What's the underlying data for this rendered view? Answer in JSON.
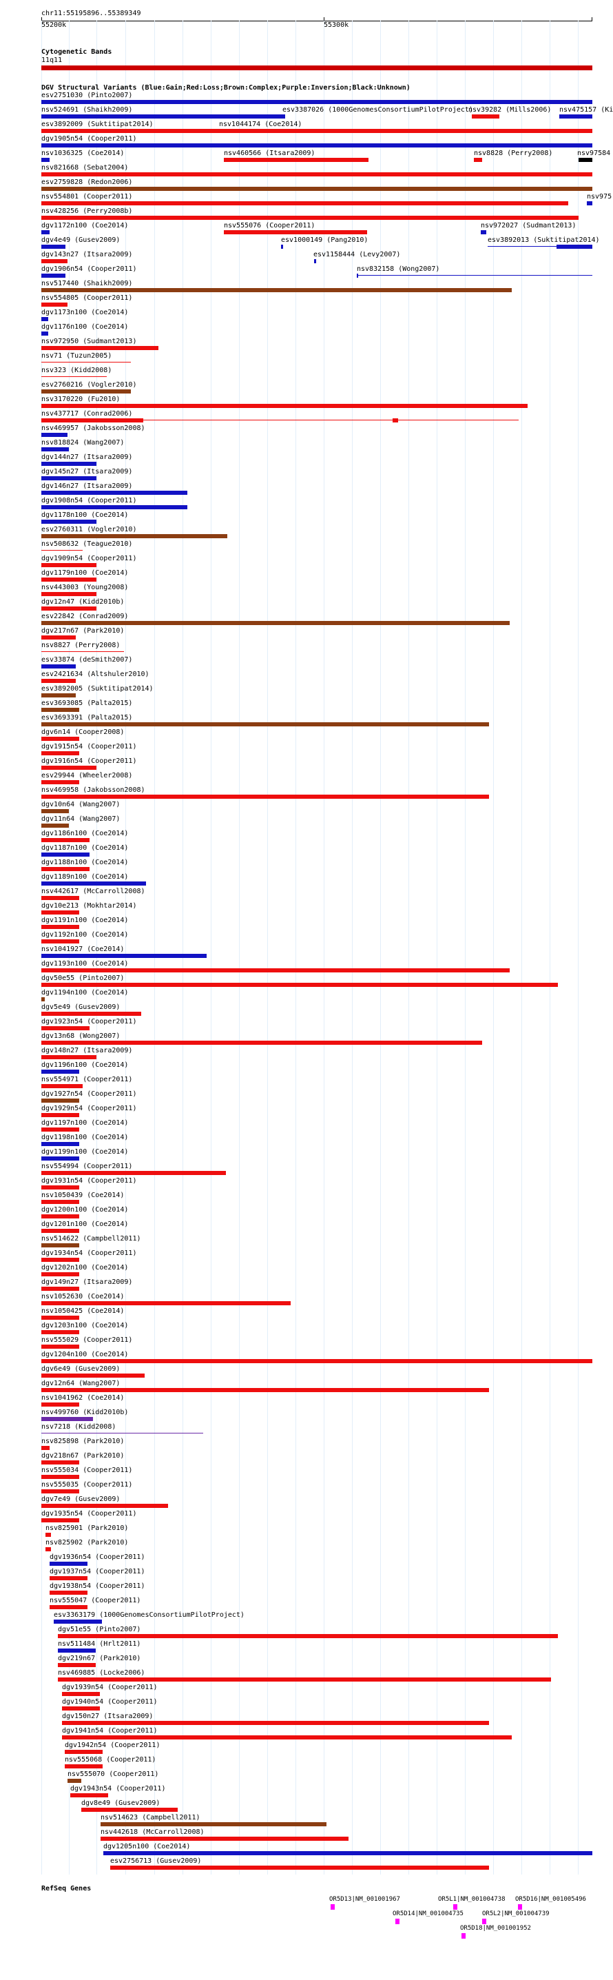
{
  "header": {
    "region": "chr11:55195896..55389349",
    "scale_left": "55200k",
    "scale_mid": "55300k"
  },
  "cytoband": {
    "title": "Cytogenetic Bands",
    "band_name": "11q11",
    "color": "#cc0000"
  },
  "variants": {
    "title": "DGV Structural Variants (Blue:Gain;Red:Loss;Brown:Complex;Purple:Inversion;Black:Unknown)",
    "colors": {
      "gain": "#1212c4",
      "loss": "#ee0e0e",
      "complex": "#8b3d12",
      "inversion": "#6a2aa8",
      "unknown": "#000000"
    },
    "labels": {
      "r1a": "esv2751030 (Pinto2007)",
      "r2a": "nsv524691 (Shaikh2009)",
      "r2b": "esv3387026 (1000GenomesConsortiumPilotProject)",
      "r2c": "nsv39282 (Mills2006)",
      "r2d": "nsv475157 (Ki",
      "r3a": "esv3892009 (Suktitipat2014)",
      "r3b": "nsv1044174 (Coe2014)",
      "r4a": "dgv1905n54 (Cooper2011)",
      "r5a": "nsv1036325 (Coe2014)",
      "r5b": "nsv460566 (Itsara2009)",
      "r5c": "nsv8828 (Perry2008)",
      "r5d": "nsv97584",
      "r6a": "nsv821668 (Sebat2004)",
      "r7a": "esv2759828 (Redon2006)",
      "r8a": "nsv554801 (Cooper2011)",
      "r8b": "nsv975",
      "r9a": "nsv428256 (Perry2008b)",
      "r10a": "dgv1172n100 (Coe2014)",
      "r10b": "nsv555076 (Cooper2011)",
      "r10c": "nsv972027 (Sudmant2013)",
      "r11a": "dgv4e49 (Gusev2009)",
      "r11b": "esv1000149 (Pang2010)",
      "r11c": "esv3892013 (Suktitipat2014)",
      "r12a": "dgv143n27 (Itsara2009)",
      "r12b": "esv1158444 (Levy2007)",
      "r13a": "dgv1906n54 (Cooper2011)",
      "r13b": "nsv832158 (Wong2007)",
      "r14": "nsv517440 (Shaikh2009)",
      "r15": "nsv554805 (Cooper2011)",
      "r16": "dgv1173n100 (Coe2014)",
      "r17": "dgv1176n100 (Coe2014)",
      "r18": "nsv972950 (Sudmant2013)",
      "r19": "nsv71 (Tuzun2005)",
      "r20": "nsv323 (Kidd2008)",
      "r21": "esv2760216 (Vogler2010)",
      "r22": "nsv3170220 (Fu2010)",
      "r23": "nsv437717 (Conrad2006)",
      "r24": "nsv469957 (Jakobsson2008)",
      "r25": "nsv818824 (Wang2007)",
      "r26": "dgv144n27 (Itsara2009)",
      "r27": "dgv145n27 (Itsara2009)",
      "r28": "dgv146n27 (Itsara2009)",
      "r29": "dgv1908n54 (Cooper2011)",
      "r30": "dgv1178n100 (Coe2014)",
      "r31": "esv2760311 (Vogler2010)",
      "r32": "nsv508632 (Teague2010)",
      "r33": "dgv1909n54 (Cooper2011)",
      "r34": "dgv1179n100 (Coe2014)",
      "r35": "nsv443003 (Young2008)",
      "r36": "dgv12n47 (Kidd2010b)",
      "r37": "esv22842 (Conrad2009)",
      "r38": "dgv217n67 (Park2010)",
      "r39": "nsv8827 (Perry2008)",
      "r40": "esv33874 (deSmith2007)",
      "r41": "esv2421634 (Altshuler2010)",
      "r42": "esv3892005 (Suktitipat2014)",
      "r43": "esv3693085 (Palta2015)",
      "r44": "esv3693391 (Palta2015)",
      "r45": "dgv6n14 (Cooper2008)",
      "r46": "dgv1915n54 (Cooper2011)",
      "r47": "dgv1916n54 (Cooper2011)",
      "r48": "esv29944 (Wheeler2008)",
      "r49": "nsv469958 (Jakobsson2008)",
      "r50": "dgv10n64 (Wang2007)",
      "r51": "dgv11n64 (Wang2007)",
      "r52": "dgv1186n100 (Coe2014)",
      "r53": "dgv1187n100 (Coe2014)",
      "r54": "dgv1188n100 (Coe2014)",
      "r55": "dgv1189n100 (Coe2014)",
      "r56": "nsv442617 (McCarroll2008)",
      "r57": "dgv10e213 (Mokhtar2014)",
      "r58": "dgv1191n100 (Coe2014)",
      "r59": "dgv1192n100 (Coe2014)",
      "r60": "nsv1041927 (Coe2014)",
      "r61": "dgv1193n100 (Coe2014)",
      "r62": "dgv50e55 (Pinto2007)",
      "r63": "dgv1194n100 (Coe2014)",
      "r64": "dgv5e49 (Gusev2009)",
      "r65": "dgv1923n54 (Cooper2011)",
      "r66": "dgv13n68 (Wong2007)",
      "r67": "dgv148n27 (Itsara2009)",
      "r68": "dgv1196n100 (Coe2014)",
      "r69": "nsv554971 (Cooper2011)",
      "r70": "dgv1927n54 (Cooper2011)",
      "r71": "dgv1929n54 (Cooper2011)",
      "r72": "dgv1197n100 (Coe2014)",
      "r73": "dgv1198n100 (Coe2014)",
      "r74": "dgv1199n100 (Coe2014)",
      "r75": "nsv554994 (Cooper2011)",
      "r76": "dgv1931n54 (Cooper2011)",
      "r77": "nsv1050439 (Coe2014)",
      "r78": "dgv1200n100 (Coe2014)",
      "r79": "dgv1201n100 (Coe2014)",
      "r80": "nsv514622 (Campbell2011)",
      "r81": "dgv1934n54 (Cooper2011)",
      "r82": "dgv1202n100 (Coe2014)",
      "r83": "dgv149n27 (Itsara2009)",
      "r84": "nsv1052630 (Coe2014)",
      "r85": "nsv1050425 (Coe2014)",
      "r86": "dgv1203n100 (Coe2014)",
      "r87": "nsv555029 (Cooper2011)",
      "r88": "dgv1204n100 (Coe2014)",
      "r89": "dgv6e49 (Gusev2009)",
      "r90": "dgv12n64 (Wang2007)",
      "r91": "nsv1041962 (Coe2014)",
      "r92": "nsv499760 (Kidd2010b)",
      "r93": "nsv7218 (Kidd2008)",
      "r94": "nsv825898 (Park2010)",
      "r95": "dgv218n67 (Park2010)",
      "r96": "nsv555034 (Cooper2011)",
      "r97": "nsv555035 (Cooper2011)",
      "r98": "dgv7e49 (Gusev2009)",
      "r99": "dgv1935n54 (Cooper2011)",
      "r100": "nsv825901 (Park2010)",
      "r101": "nsv825902 (Park2010)",
      "r102": "dgv1936n54 (Cooper2011)",
      "r103": "dgv1937n54 (Cooper2011)",
      "r104": "dgv1938n54 (Cooper2011)",
      "r105": "nsv555047 (Cooper2011)",
      "r106": "esv3363179 (1000GenomesConsortiumPilotProject)",
      "r107": "dgv51e55 (Pinto2007)",
      "r108": "nsv511484 (Hrlt2011)",
      "r109": "dgv219n67 (Park2010)",
      "r110": "nsv469885 (Locke2006)",
      "r111": "dgv1939n54 (Cooper2011)",
      "r112": "dgv1940n54 (Cooper2011)",
      "r113": "dgv150n27 (Itsara2009)",
      "r114": "dgv1941n54 (Cooper2011)",
      "r115": "dgv1942n54 (Cooper2011)",
      "r116": "nsv555068 (Cooper2011)",
      "r117": "nsv555070 (Cooper2011)",
      "r118": "dgv1943n54 (Cooper2011)",
      "r119": "dgv8e49 (Gusev2009)",
      "r120": "nsv514623 (Campbell2011)",
      "r121": "nsv442618 (McCarroll2008)",
      "r122": "dgv1205n100 (Coe2014)",
      "r123": "esv2756713 (Gusev2009)"
    }
  },
  "refseq": {
    "title": "RefSeq Genes",
    "g1": "OR5D13|NM_001001967",
    "g2": "OR5L1|NM_001004738",
    "g3": "OR5D16|NM_001005496",
    "g4": "OR5D14|NM_001004735",
    "g5": "OR5L2|NM_001004739",
    "g6": "OR5D18|NM_001001952",
    "gene_color": "#ff00ff"
  }
}
